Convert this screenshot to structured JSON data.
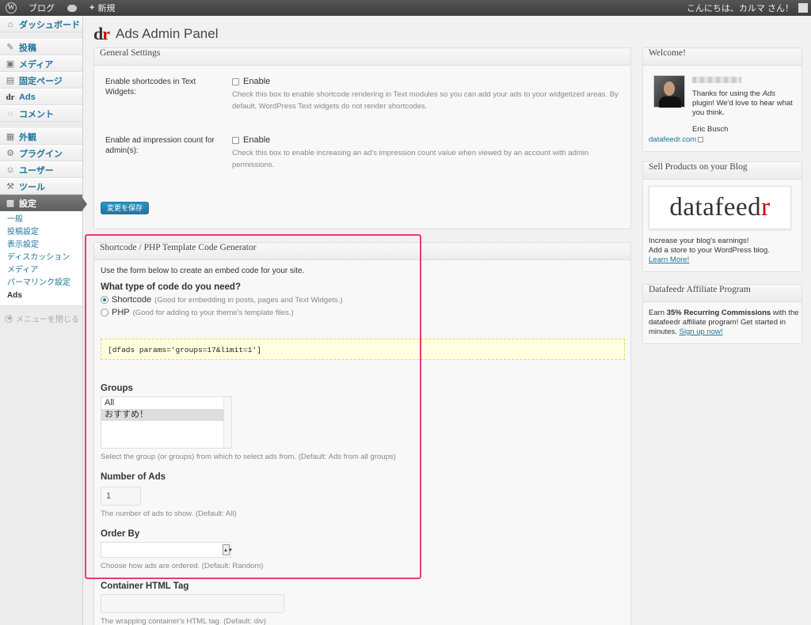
{
  "adminbar": {
    "site_name": "ブログ",
    "new_label": "新規",
    "greeting": "こんにちは、カルマ さん！"
  },
  "sidebar": {
    "items": [
      {
        "label": "ダッシュボード",
        "icon": "home-icon"
      },
      {
        "label": "投稿",
        "icon": "pin-icon"
      },
      {
        "label": "メディア",
        "icon": "media-icon"
      },
      {
        "label": "固定ページ",
        "icon": "page-icon"
      },
      {
        "label": "Ads",
        "icon": "dr-icon"
      },
      {
        "label": "コメント",
        "icon": "comment-icon"
      },
      {
        "label": "外観",
        "icon": "appearance-icon"
      },
      {
        "label": "プラグイン",
        "icon": "plugin-icon"
      },
      {
        "label": "ユーザー",
        "icon": "users-icon"
      },
      {
        "label": "ツール",
        "icon": "tools-icon"
      },
      {
        "label": "設定",
        "icon": "settings-icon"
      }
    ],
    "submenu": [
      "一般",
      "投稿設定",
      "表示設定",
      "ディスカッション",
      "メディア",
      "パーマリンク設定",
      "Ads"
    ],
    "collapse_label": "メニューを閉じる"
  },
  "page": {
    "logo_d": "d",
    "logo_r": "r",
    "title": "Ads Admin Panel"
  },
  "general": {
    "title": "General Settings",
    "shortcodes_label": "Enable shortcodes in Text Widgets:",
    "shortcodes_check": "Enable",
    "shortcodes_desc": "Check this box to enable shortcode rendering in Text modules so you can add your ads to your widgetized areas. By default, WordPress Text widgets do not render shortcodes.",
    "impression_label": "Enable ad impression count for admin(s):",
    "impression_check": "Enable",
    "impression_desc": "Check this box to enable increasing an ad's impression count value when viewed by an account with admin permissions.",
    "save_label": "変更を保存"
  },
  "generator": {
    "title": "Shortcode / PHP Template Code Generator",
    "intro": "Use the form below to create an embed code for your site.",
    "question": "What type of code do you need?",
    "opt_shortcode": "Shortcode",
    "opt_shortcode_hint": "(Good for embedding in posts, pages and Text Widgets.)",
    "opt_php": "PHP",
    "opt_php_hint": "(Good for adding to your theme's template files.)",
    "code": "[dfads params='groups=17&limit=1']",
    "groups_title": "Groups",
    "groups_options": [
      "All",
      "おすすめ！"
    ],
    "groups_desc": "Select the group (or groups) from which to select ads from. (Default: Ads from all groups)",
    "num_title": "Number of Ads",
    "num_value": "1",
    "num_desc": "The number of ads to show. (Default: All)",
    "order_title": "Order By",
    "order_value": "",
    "order_desc": "Choose how ads are ordered. (Default: Random)",
    "container_title": "Container HTML Tag",
    "container_desc": "The wrapping container's HTML tag. (Default: div)"
  },
  "welcome": {
    "title": "Welcome!",
    "text_pre": "Thanks for using the ",
    "text_em": "Ads",
    "text_post": " plugin! We'd love to hear what you think.",
    "signature": "Eric Busch",
    "link": "datafeedr.com"
  },
  "sell": {
    "title": "Sell Products on your Blog",
    "logo_main": "datafeed",
    "logo_r": "r",
    "line1": "Increase your blog's earnings!",
    "line2": "Add a store to your WordPress blog.",
    "link": "Learn More!"
  },
  "affiliate": {
    "title": "Datafeedr Affiliate Program",
    "pre": "Earn ",
    "bold": "35% Recurring Commissions",
    "post": " with the datafeedr affiliate program! Get started in minutes. ",
    "link": "Sign up now!"
  },
  "colors": {
    "link": "#21759b",
    "highlight": "#ee3a76",
    "code_bg": "#ffffe0"
  }
}
